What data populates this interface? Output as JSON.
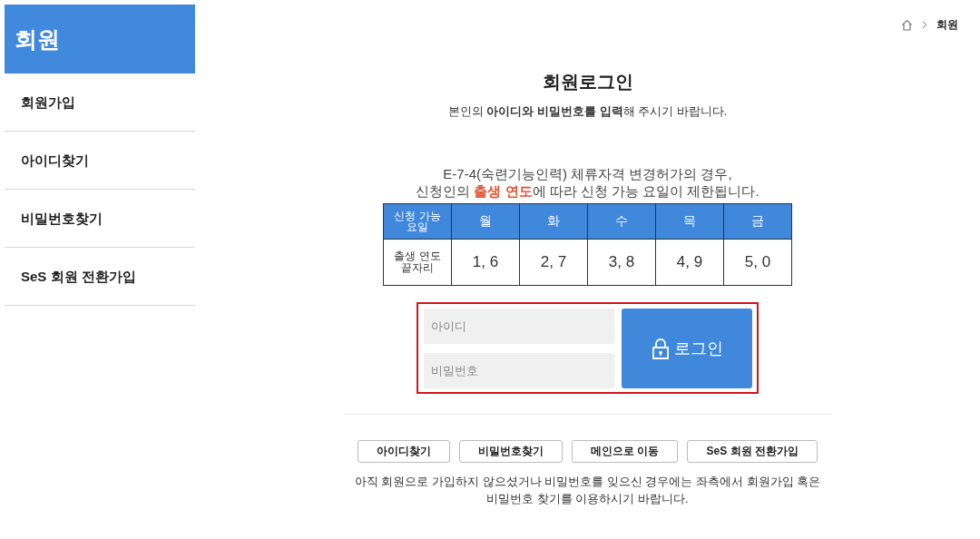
{
  "sidebar": {
    "title": "회원",
    "items": [
      {
        "label": "회원가입"
      },
      {
        "label": "아이디찾기"
      },
      {
        "label": "비밀번호찾기"
      },
      {
        "label": "SeS 회원 전환가입"
      }
    ]
  },
  "breadcrumb": {
    "current": "회원"
  },
  "login": {
    "title": "회원로그인",
    "subtitle": "본인의 **아이디와** **비밀번호를** **입력**해 주시기 바랍니다.",
    "notice": [
      "E-7-4(숙련기능인력) 체류자격 변경허가의 경우,",
      "신청인의 **출생 연도**에 따라 신청 가능 요일이 제한됩니다."
    ],
    "schedule": {
      "columns": [
        "신청 가능 요일",
        "월",
        "화",
        "수",
        "목",
        "금"
      ],
      "rows": [
        [
          "출생 연도 끝자리",
          "1, 6",
          "2, 7",
          "3, 8",
          "4, 9",
          "5, 0"
        ]
      ]
    },
    "id_field": {
      "placeholder": "아이디"
    },
    "password_field": {
      "placeholder": "비밀번호"
    },
    "login_button": "로그인"
  },
  "links": [
    "아이디찾기",
    "비밀번호찾기",
    "메인으로 이동",
    "SeS 회원 전환가입"
  ],
  "help_text": "아직 회원으로 가입하지 않으셨거나 비밀번호를 잊으신 경우에는 좌측에서 회원가입 혹은 비밀번호 찾기를 이용하시기 바랍니다."
}
